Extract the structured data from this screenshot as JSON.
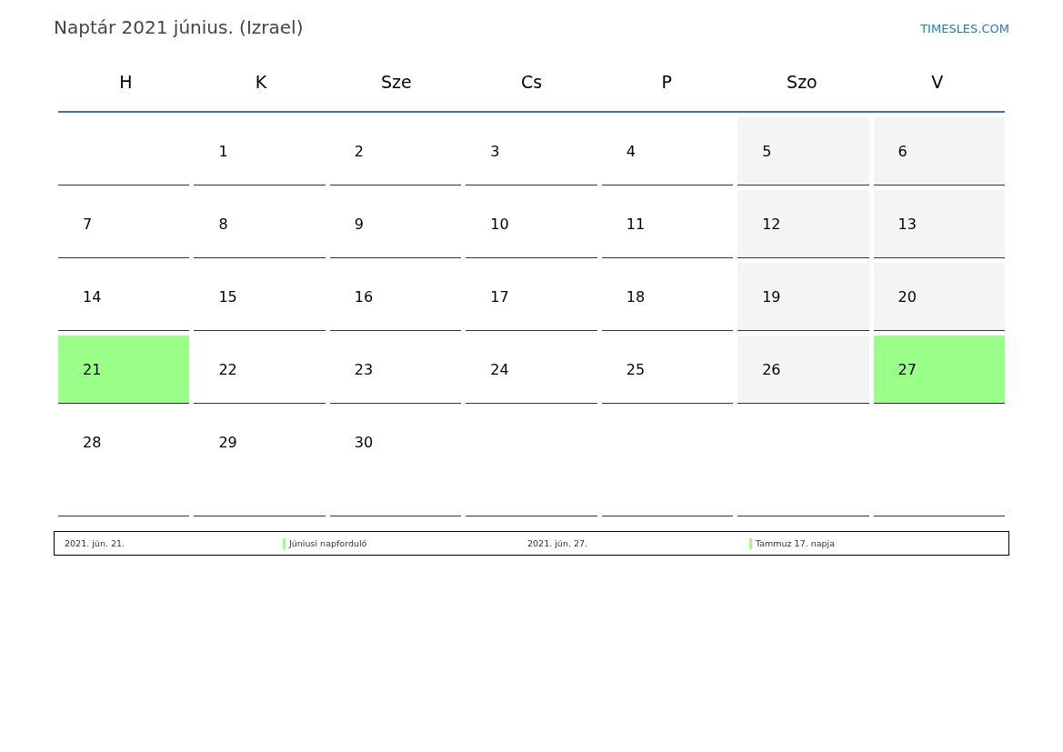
{
  "title": "Naptár 2021 június. (Izrael)",
  "site": "TIMESLES.COM",
  "weekdays": [
    "H",
    "K",
    "Sze",
    "Cs",
    "P",
    "Szo",
    "V"
  ],
  "weeks": [
    [
      {
        "kind": "workday"
      },
      {
        "day": "1",
        "kind": "workday"
      },
      {
        "day": "2",
        "kind": "workday"
      },
      {
        "day": "3",
        "kind": "workday"
      },
      {
        "day": "4",
        "kind": "workday"
      },
      {
        "day": "5",
        "kind": "weekend"
      },
      {
        "day": "6",
        "kind": "weekend"
      }
    ],
    [
      {
        "day": "7",
        "kind": "workday"
      },
      {
        "day": "8",
        "kind": "workday"
      },
      {
        "day": "9",
        "kind": "workday"
      },
      {
        "day": "10",
        "kind": "workday"
      },
      {
        "day": "11",
        "kind": "workday"
      },
      {
        "day": "12",
        "kind": "weekend"
      },
      {
        "day": "13",
        "kind": "weekend"
      }
    ],
    [
      {
        "day": "14",
        "kind": "workday"
      },
      {
        "day": "15",
        "kind": "workday"
      },
      {
        "day": "16",
        "kind": "workday"
      },
      {
        "day": "17",
        "kind": "workday"
      },
      {
        "day": "18",
        "kind": "workday"
      },
      {
        "day": "19",
        "kind": "weekend"
      },
      {
        "day": "20",
        "kind": "weekend"
      }
    ],
    [
      {
        "day": "21",
        "kind": "holiday"
      },
      {
        "day": "22",
        "kind": "workday"
      },
      {
        "day": "23",
        "kind": "workday"
      },
      {
        "day": "24",
        "kind": "workday"
      },
      {
        "day": "25",
        "kind": "workday"
      },
      {
        "day": "26",
        "kind": "weekend"
      },
      {
        "day": "27",
        "kind": "holiday"
      }
    ],
    [
      {
        "day": "28",
        "kind": "workday"
      },
      {
        "day": "29",
        "kind": "workday"
      },
      {
        "day": "30",
        "kind": "workday"
      },
      {
        "kind": "workday"
      },
      {
        "kind": "workday"
      },
      {
        "kind": "workday"
      },
      {
        "kind": "workday"
      }
    ]
  ],
  "legend": [
    {
      "date": "2021. jún. 21.",
      "name": "Júniusi napforduló",
      "color": "#99ff88"
    },
    {
      "date": "2021. jún. 27.",
      "name": "Tammuz 17. napja",
      "color": "#99ff88"
    }
  ]
}
